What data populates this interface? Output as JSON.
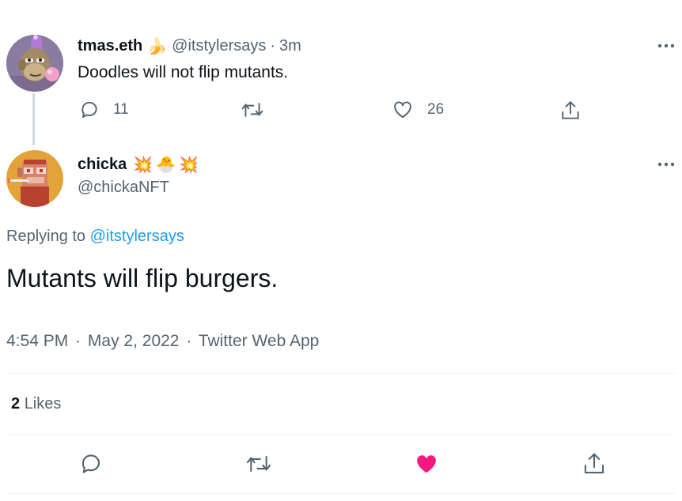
{
  "parent_tweet": {
    "display_name": "tmas.eth",
    "name_emoji": "🍌",
    "handle": "@itstylersays",
    "separator": "·",
    "time": "3m",
    "text": "Doodles will not flip mutants.",
    "replies": "11",
    "likes": "26",
    "avatar_icon": "bored-ape-party-hat-avatar"
  },
  "main_tweet": {
    "display_name": "chicka",
    "name_emojis": [
      "💥",
      "🐣",
      "💥"
    ],
    "handle": "@chickaNFT",
    "replying_prefix": "Replying to",
    "replying_handle": "@itstylersays",
    "text": "Mutants will flip burgers.",
    "meta": {
      "time": "4:54 PM",
      "separator": "·",
      "date": "May 2, 2022",
      "source": "Twitter Web App"
    },
    "likes_count": "2",
    "likes_label": "Likes",
    "avatar_icon": "pixel-ape-avatar"
  },
  "icons": {
    "reply": "reply-icon",
    "retweet": "retweet-icon",
    "like": "heart-icon",
    "share": "share-icon",
    "more": "more-icon"
  },
  "colors": {
    "link": "#1d9bf0",
    "liked": "#f91880",
    "muted": "#536471",
    "text": "#0f1419"
  }
}
